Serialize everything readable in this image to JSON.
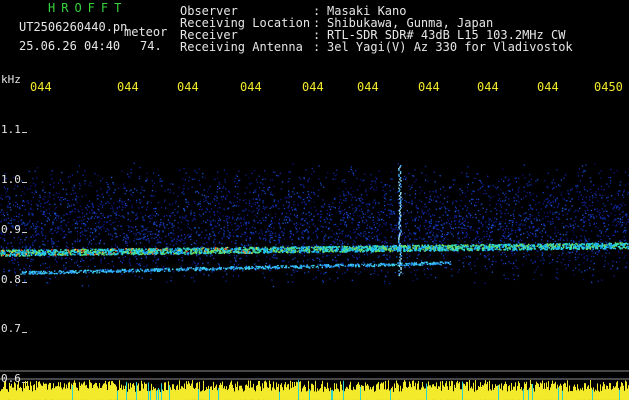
{
  "header": {
    "app_title": "HROFFT",
    "filename": "UT2506260440.pn",
    "mode": "meteor",
    "datetime": "25.06.26 04:40",
    "counter": "74.",
    "info_labels": [
      "Observer",
      "Receiving Location",
      "Receiver",
      "Receiving Antenna"
    ],
    "info_separator": ":",
    "info_values": [
      "Masaki Kano",
      "Shibukawa, Gunma, Japan",
      "RTL-SDR SDR# 43dB L15 103.2MHz CW",
      "3el Yagi(V) Az 330 for Vladivostok"
    ]
  },
  "axes": {
    "y_unit": "kHz",
    "y_ticks": [
      "1.1",
      "1.0",
      "0.9",
      "0.8",
      "0.7",
      "0.6"
    ],
    "time_ticks": [
      "044",
      "044",
      "044",
      "044",
      "044",
      "044",
      "044",
      "044",
      "044",
      "0450"
    ]
  },
  "colors": {
    "background": "#000000",
    "header_text": "#e6e6e6",
    "title_green": "#36d13c",
    "time_labels": "#f2ea2a",
    "noise_bar": "#f2ea2a",
    "baseline": "#8c8c8c"
  },
  "spectrogram": {
    "trace_freq_khz": [
      0.855,
      0.86,
      0.865,
      0.87
    ],
    "secondary_trace_freq_khz": [
      0.815,
      0.825,
      0.835
    ],
    "ping_freq_range_khz": [
      0.8,
      1.0
    ],
    "noise_band_khz": [
      0.8,
      1.0
    ]
  }
}
